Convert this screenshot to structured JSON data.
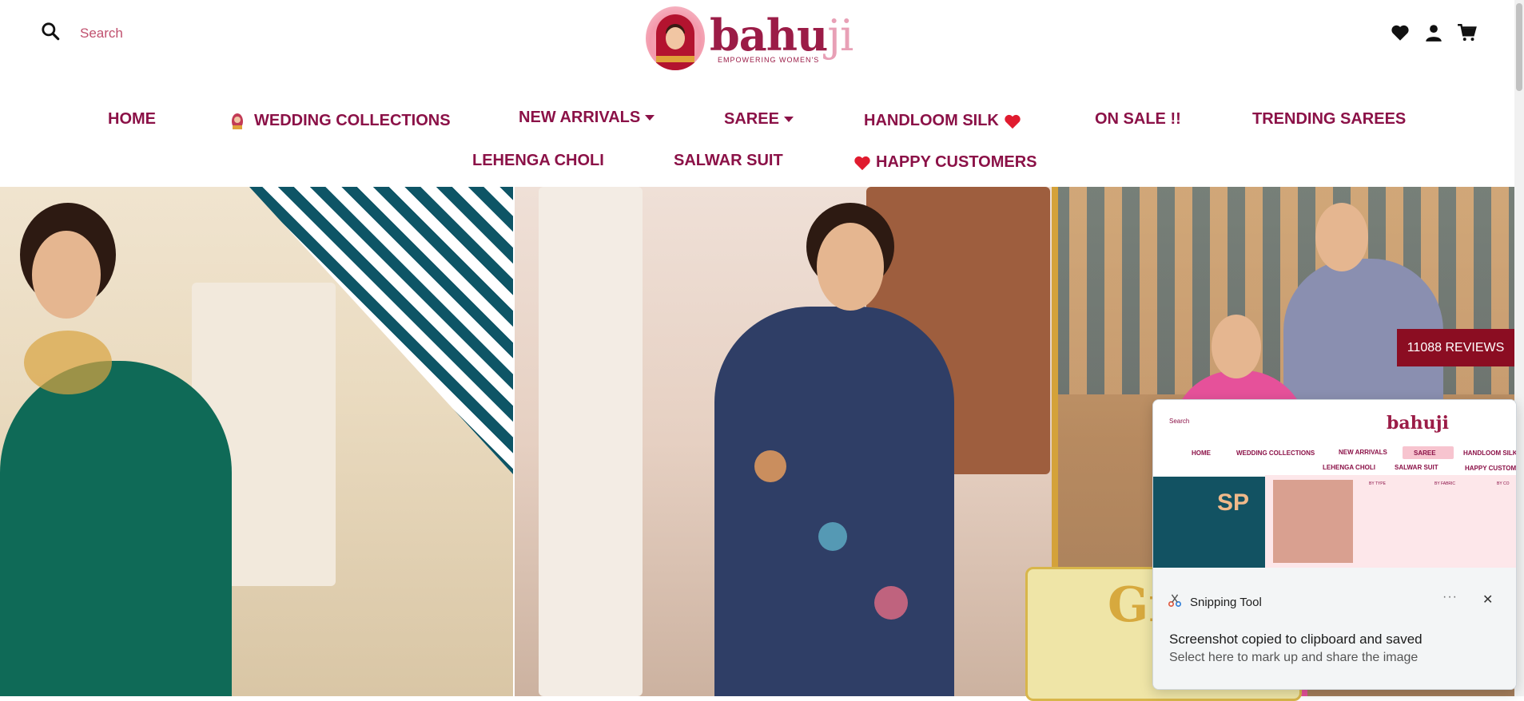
{
  "header": {
    "search": {
      "placeholder": "Search"
    },
    "logo": {
      "word": "bahu",
      "word_accent": "ji",
      "tagline": "EMPOWERING WOMEN'S"
    },
    "icons": [
      "heart-icon",
      "user-icon",
      "cart-icon"
    ]
  },
  "nav": {
    "row1": [
      {
        "label": "HOME"
      },
      {
        "label": "WEDDING COLLECTIONS"
      },
      {
        "label": "NEW ARRIVALS"
      },
      {
        "label": "SAREE"
      },
      {
        "label": "HANDLOOM SILK"
      },
      {
        "label": "ON SALE !!"
      },
      {
        "label": "TRENDING SAREES"
      }
    ],
    "row2": [
      {
        "label": "LEHENGA CHOLI"
      },
      {
        "label": "SALWAR SUIT"
      },
      {
        "label": "HAPPY CUSTOMERS"
      }
    ]
  },
  "hero": {
    "banner_text": "Gr"
  },
  "reviews": {
    "label": "11088 REVIEWS"
  },
  "toast": {
    "app_name": "Snipping Tool",
    "more": "···",
    "close": "✕",
    "title": "Screenshot copied to clipboard and saved",
    "subtitle": "Select here to mark up and share the image",
    "thumbnail": {
      "search": "Search",
      "logo": "bahuji",
      "nav_row1": [
        "HOME",
        "WEDDING COLLECTIONS",
        "NEW ARRIVALS",
        "SAREE",
        "HANDLOOM SILK"
      ],
      "nav_row2": [
        "LEHENGA CHOLI",
        "SALWAR SUIT",
        "HAPPY CUSTOM"
      ],
      "hero_text": "SP",
      "menu_headers": [
        "BY TYPE",
        "BY FABRIC",
        "BY CO"
      ]
    }
  },
  "colors": {
    "brand": "#8b1147",
    "reviews_bg": "#8b0d22",
    "heart": "#e01b2f"
  }
}
